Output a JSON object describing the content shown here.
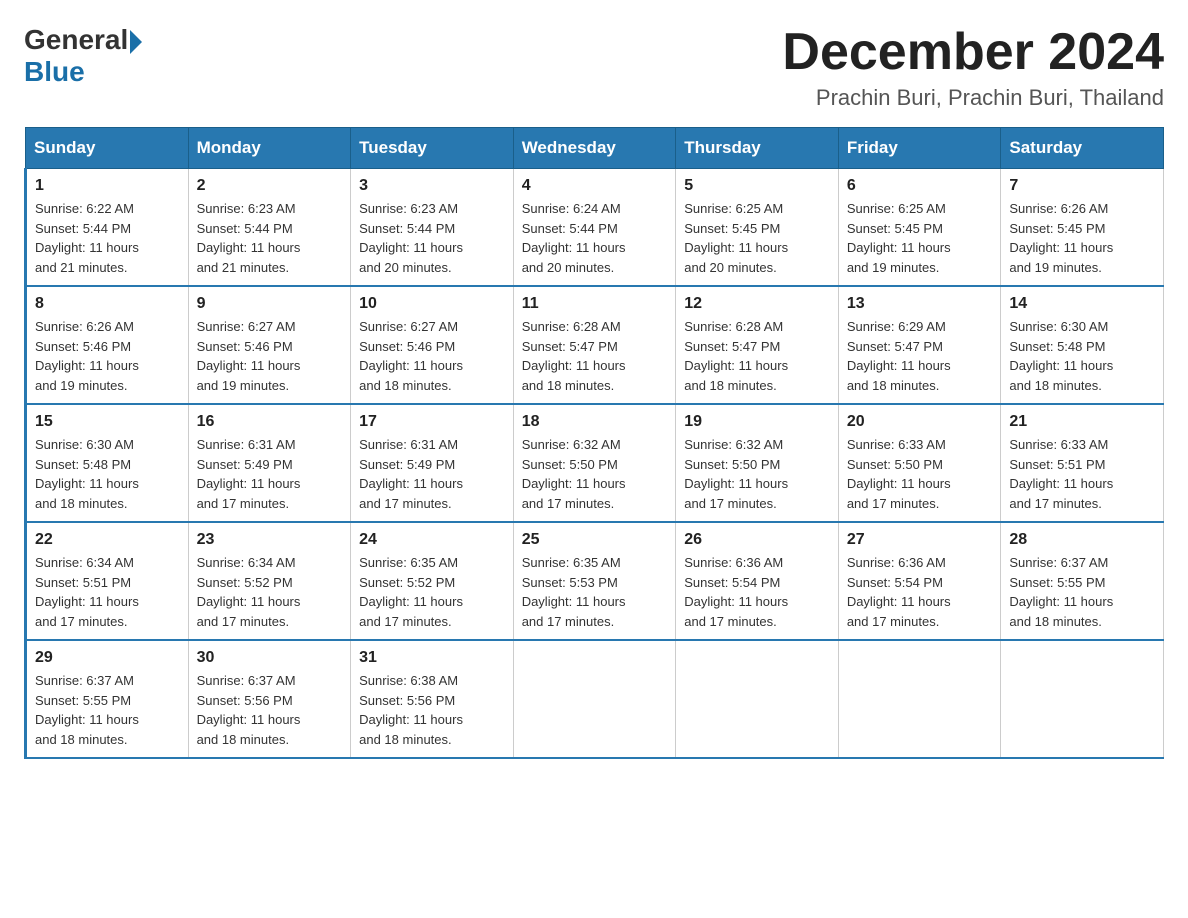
{
  "header": {
    "logo_general": "General",
    "logo_blue": "Blue",
    "month_title": "December 2024",
    "location": "Prachin Buri, Prachin Buri, Thailand"
  },
  "days_of_week": [
    "Sunday",
    "Monday",
    "Tuesday",
    "Wednesday",
    "Thursday",
    "Friday",
    "Saturday"
  ],
  "weeks": [
    [
      {
        "day": "1",
        "sunrise": "6:22 AM",
        "sunset": "5:44 PM",
        "daylight": "11 hours and 21 minutes."
      },
      {
        "day": "2",
        "sunrise": "6:23 AM",
        "sunset": "5:44 PM",
        "daylight": "11 hours and 21 minutes."
      },
      {
        "day": "3",
        "sunrise": "6:23 AM",
        "sunset": "5:44 PM",
        "daylight": "11 hours and 20 minutes."
      },
      {
        "day": "4",
        "sunrise": "6:24 AM",
        "sunset": "5:44 PM",
        "daylight": "11 hours and 20 minutes."
      },
      {
        "day": "5",
        "sunrise": "6:25 AM",
        "sunset": "5:45 PM",
        "daylight": "11 hours and 20 minutes."
      },
      {
        "day": "6",
        "sunrise": "6:25 AM",
        "sunset": "5:45 PM",
        "daylight": "11 hours and 19 minutes."
      },
      {
        "day": "7",
        "sunrise": "6:26 AM",
        "sunset": "5:45 PM",
        "daylight": "11 hours and 19 minutes."
      }
    ],
    [
      {
        "day": "8",
        "sunrise": "6:26 AM",
        "sunset": "5:46 PM",
        "daylight": "11 hours and 19 minutes."
      },
      {
        "day": "9",
        "sunrise": "6:27 AM",
        "sunset": "5:46 PM",
        "daylight": "11 hours and 19 minutes."
      },
      {
        "day": "10",
        "sunrise": "6:27 AM",
        "sunset": "5:46 PM",
        "daylight": "11 hours and 18 minutes."
      },
      {
        "day": "11",
        "sunrise": "6:28 AM",
        "sunset": "5:47 PM",
        "daylight": "11 hours and 18 minutes."
      },
      {
        "day": "12",
        "sunrise": "6:28 AM",
        "sunset": "5:47 PM",
        "daylight": "11 hours and 18 minutes."
      },
      {
        "day": "13",
        "sunrise": "6:29 AM",
        "sunset": "5:47 PM",
        "daylight": "11 hours and 18 minutes."
      },
      {
        "day": "14",
        "sunrise": "6:30 AM",
        "sunset": "5:48 PM",
        "daylight": "11 hours and 18 minutes."
      }
    ],
    [
      {
        "day": "15",
        "sunrise": "6:30 AM",
        "sunset": "5:48 PM",
        "daylight": "11 hours and 18 minutes."
      },
      {
        "day": "16",
        "sunrise": "6:31 AM",
        "sunset": "5:49 PM",
        "daylight": "11 hours and 17 minutes."
      },
      {
        "day": "17",
        "sunrise": "6:31 AM",
        "sunset": "5:49 PM",
        "daylight": "11 hours and 17 minutes."
      },
      {
        "day": "18",
        "sunrise": "6:32 AM",
        "sunset": "5:50 PM",
        "daylight": "11 hours and 17 minutes."
      },
      {
        "day": "19",
        "sunrise": "6:32 AM",
        "sunset": "5:50 PM",
        "daylight": "11 hours and 17 minutes."
      },
      {
        "day": "20",
        "sunrise": "6:33 AM",
        "sunset": "5:50 PM",
        "daylight": "11 hours and 17 minutes."
      },
      {
        "day": "21",
        "sunrise": "6:33 AM",
        "sunset": "5:51 PM",
        "daylight": "11 hours and 17 minutes."
      }
    ],
    [
      {
        "day": "22",
        "sunrise": "6:34 AM",
        "sunset": "5:51 PM",
        "daylight": "11 hours and 17 minutes."
      },
      {
        "day": "23",
        "sunrise": "6:34 AM",
        "sunset": "5:52 PM",
        "daylight": "11 hours and 17 minutes."
      },
      {
        "day": "24",
        "sunrise": "6:35 AM",
        "sunset": "5:52 PM",
        "daylight": "11 hours and 17 minutes."
      },
      {
        "day": "25",
        "sunrise": "6:35 AM",
        "sunset": "5:53 PM",
        "daylight": "11 hours and 17 minutes."
      },
      {
        "day": "26",
        "sunrise": "6:36 AM",
        "sunset": "5:54 PM",
        "daylight": "11 hours and 17 minutes."
      },
      {
        "day": "27",
        "sunrise": "6:36 AM",
        "sunset": "5:54 PM",
        "daylight": "11 hours and 17 minutes."
      },
      {
        "day": "28",
        "sunrise": "6:37 AM",
        "sunset": "5:55 PM",
        "daylight": "11 hours and 18 minutes."
      }
    ],
    [
      {
        "day": "29",
        "sunrise": "6:37 AM",
        "sunset": "5:55 PM",
        "daylight": "11 hours and 18 minutes."
      },
      {
        "day": "30",
        "sunrise": "6:37 AM",
        "sunset": "5:56 PM",
        "daylight": "11 hours and 18 minutes."
      },
      {
        "day": "31",
        "sunrise": "6:38 AM",
        "sunset": "5:56 PM",
        "daylight": "11 hours and 18 minutes."
      },
      null,
      null,
      null,
      null
    ]
  ],
  "sunrise_label": "Sunrise:",
  "sunset_label": "Sunset:",
  "daylight_label": "Daylight:"
}
